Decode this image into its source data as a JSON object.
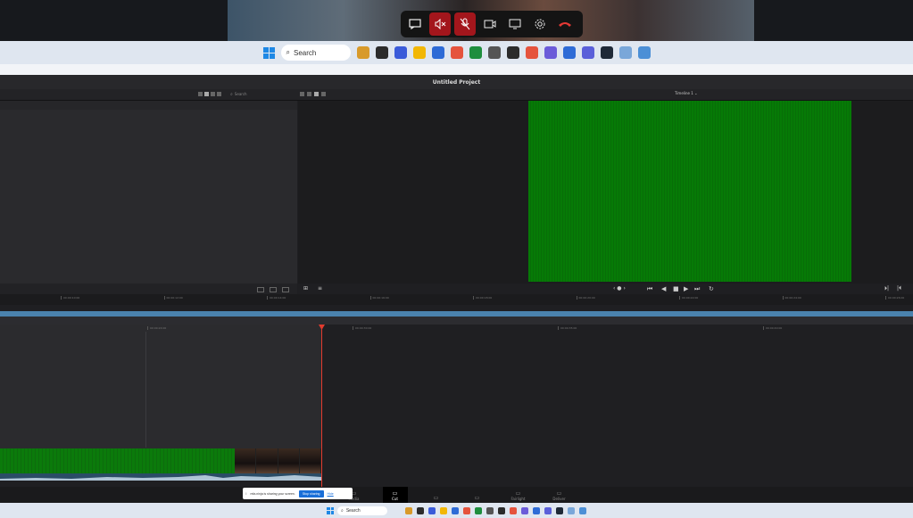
{
  "video_call": {
    "controls": [
      {
        "name": "chat-icon",
        "glyph": "▭",
        "style": "normal"
      },
      {
        "name": "speaker-mute-icon",
        "glyph": "🔇",
        "style": "red"
      },
      {
        "name": "mic-mute-icon",
        "glyph": "🎙",
        "style": "red"
      },
      {
        "name": "camera-icon",
        "glyph": "▭",
        "style": "normal"
      },
      {
        "name": "share-screen-icon",
        "glyph": "▭",
        "style": "normal"
      },
      {
        "name": "settings-icon",
        "glyph": "⚙",
        "style": "normal"
      },
      {
        "name": "hang-up-icon",
        "glyph": "☎",
        "style": "hang"
      }
    ]
  },
  "outer_taskbar": {
    "search_label": "Search",
    "icon_colors": [
      "#d89a2a",
      "#2b2b2b",
      "#3a5bd9",
      "#f2b705",
      "#2e6bd6",
      "#e5533d",
      "#1e8e3e",
      "#555555",
      "#2b2b2b",
      "#e5533d",
      "#6b5bd9",
      "#2e6bd6",
      "#5a5fd9",
      "#1f2937",
      "#7aa7d9",
      "#4c8fd6"
    ]
  },
  "resolve": {
    "project_title": "Untitled Project",
    "search_placeholder": "Search",
    "timeline_name": "Timeline 1",
    "ruler_top": [
      "00:00:10:00",
      "00:00:12:00",
      "00:00:14:00",
      "00:00:16:00",
      "00:00:18:00",
      "00:00:20:00",
      "00:00:22:00",
      "00:00:24:00",
      "00:00:26:00"
    ],
    "ruler_2": [
      "00:00:24:00",
      "00:00:30:00",
      "00:00:35:00",
      "00:00:40:00"
    ],
    "page_tabs": [
      {
        "label": "Media",
        "icon": "media-icon"
      },
      {
        "label": "Cut",
        "icon": "cut-icon",
        "active": true
      },
      {
        "label": "",
        "icon": "edit-icon"
      },
      {
        "label": "",
        "icon": "fusion-icon"
      },
      {
        "label": "Fairlight",
        "icon": "fairlight-icon"
      },
      {
        "label": "Deliver",
        "icon": "deliver-icon"
      }
    ]
  },
  "share_notice": {
    "message": "mfa.ninja is sharing your screen.",
    "stop_label": "Stop sharing",
    "hide_label": "Hide"
  },
  "bottom_taskbar": {
    "search_label": "Search"
  }
}
